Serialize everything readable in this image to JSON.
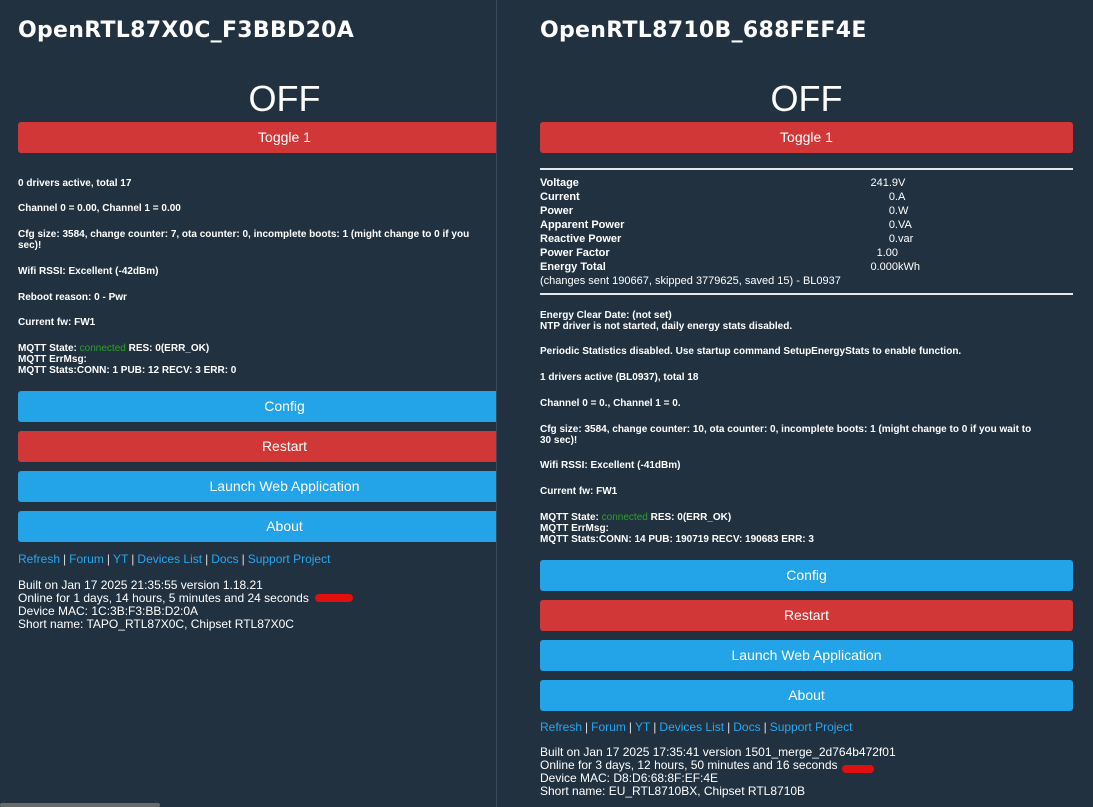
{
  "left": {
    "title": "OpenRTL87X0C_F3BBD20A",
    "state": "OFF",
    "toggle": "Toggle 1",
    "drivers": "0 drivers active, total 17",
    "channels": "Channel 0 = 0.00, Channel 1 = 0.00",
    "cfg_line1": "Cfg size: 3584, change counter: 7, ota counter: 0, incomplete boots: 1 (might change to 0 if you",
    "cfg_line2": "sec)!",
    "wifi": "Wifi RSSI: Excellent (-42dBm)",
    "reboot": "Reboot reason: 0 - Pwr",
    "fw": "Current fw: FW1",
    "mqtt_state_label": "MQTT State:",
    "mqtt_state_value": "connected",
    "mqtt_res": "RES: 0(ERR_OK)",
    "mqtt_errmsg": "MQTT ErrMsg:",
    "mqtt_stats": "MQTT Stats:CONN: 1 PUB: 12 RECV: 3 ERR: 0",
    "buttons": {
      "config": "Config",
      "restart": "Restart",
      "launch": "Launch Web Application",
      "about": "About"
    },
    "links": [
      "Refresh",
      "Forum",
      "YT",
      "Devices List",
      "Docs",
      "Support Project"
    ],
    "separator": "|",
    "built": "Built on Jan 17 2025 21:35:55 version 1.18.21",
    "online": "Online for 1 days, 14 hours, 5 minutes and 24 seconds",
    "mac": "Device MAC: 1C:3B:F3:BB:D2:0A",
    "short_name": "Short name: TAPO_RTL87X0C, Chipset RTL87X0C"
  },
  "right": {
    "title": "OpenRTL8710B_688FEF4E",
    "state": "OFF",
    "toggle": "Toggle 1",
    "energy": [
      {
        "label": "Voltage",
        "value": "241.9",
        "unit": "V"
      },
      {
        "label": "Current",
        "value": "0.",
        "unit": "A"
      },
      {
        "label": "Power",
        "value": "0.",
        "unit": "W"
      },
      {
        "label": "Apparent Power",
        "value": "0.",
        "unit": "VA"
      },
      {
        "label": "Reactive Power",
        "value": "0.",
        "unit": "var"
      },
      {
        "label": "Power Factor",
        "value": "1.00",
        "unit": ""
      },
      {
        "label": "Energy Total",
        "value": "0.000",
        "unit": "kWh"
      }
    ],
    "energy_note": "(changes sent 190667, skipped 3779625, saved 15) - BL0937",
    "clear_date": "Energy Clear Date: (not set)",
    "ntp": "NTP driver is not started, daily energy stats disabled.",
    "periodic": "Periodic Statistics disabled. Use startup command SetupEnergyStats to enable function.",
    "drivers": "1 drivers active (BL0937), total 18",
    "channels": "Channel 0 = 0., Channel 1 = 0.",
    "cfg_line1": "Cfg size: 3584, change counter: 10, ota counter: 0, incomplete boots: 1 (might change to 0 if you wait to",
    "cfg_line2": "30 sec)!",
    "wifi": "Wifi RSSI: Excellent (-41dBm)",
    "fw": "Current fw: FW1",
    "mqtt_state_label": "MQTT State:",
    "mqtt_state_value": "connected",
    "mqtt_res": "RES: 0(ERR_OK)",
    "mqtt_errmsg": "MQTT ErrMsg:",
    "mqtt_stats": "MQTT Stats:CONN: 14 PUB: 190719 RECV: 190683 ERR: 3",
    "buttons": {
      "config": "Config",
      "restart": "Restart",
      "launch": "Launch Web Application",
      "about": "About"
    },
    "links": [
      "Refresh",
      "Forum",
      "YT",
      "Devices List",
      "Docs",
      "Support Project"
    ],
    "separator": "|",
    "built": "Built on Jan 17 2025 17:35:41 version 1501_merge_2d764b472f01",
    "online": "Online for 3 days, 12 hours, 50 minutes and 16 seconds",
    "mac": "Device MAC: D8:D6:68:8F:EF:4E",
    "short_name": "Short name: EU_RTL8710BX, Chipset RTL8710B"
  },
  "colors": {
    "background": "#213140",
    "red": "#d23737",
    "blue": "#23a3e8",
    "link": "#28a8f0",
    "connected": "#28a428"
  }
}
